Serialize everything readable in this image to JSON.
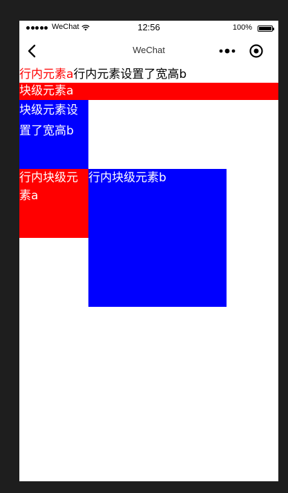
{
  "status_bar": {
    "carrier": "WeChat",
    "time": "12:56",
    "battery": "100%"
  },
  "nav": {
    "title": "WeChat",
    "back_icon": "chevron-left-icon",
    "more_icon": "more-dots-icon",
    "close_icon": "target-circle-icon"
  },
  "content": {
    "inline_a": "行内元素a",
    "inline_b": "行内元素设置了宽高b",
    "block_a": "块级元素a",
    "block_b": "块级元素设置了宽高b",
    "inline_block_a": "行内块级元素a",
    "inline_block_b": "行内块级元素b"
  },
  "colors": {
    "red": "#ff0000",
    "blue": "#0000ff",
    "background": "#1e1e1e"
  }
}
